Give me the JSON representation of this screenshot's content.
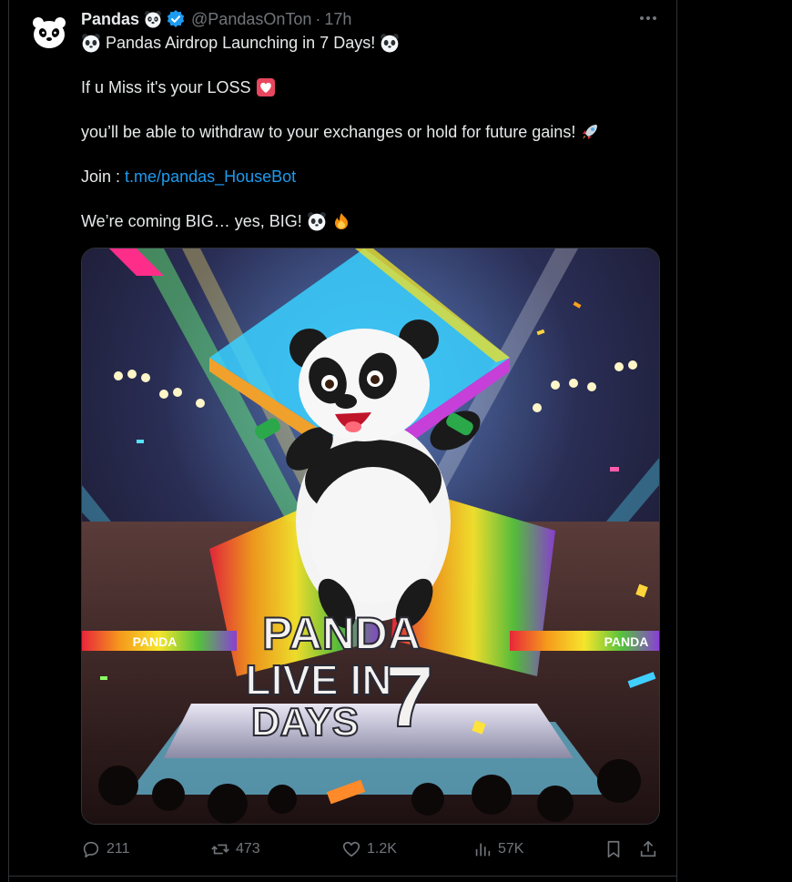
{
  "tweet": {
    "author_name": "Pandas",
    "handle": "@PandasOnTon",
    "separator": "·",
    "time": "17h",
    "line1": "Pandas Airdrop Launching in 7 Days!",
    "line2": "If u Miss it's your LOSS",
    "line3": "you’ll be able to withdraw to your exchanges or hold for future gains!",
    "line4_prefix": "Join :",
    "line4_link": "t.me/pandas_HouseBot",
    "line5": "We’re coming BIG… yes, BIG!",
    "icons": [
      "panda-face-emoji",
      "verified-badge",
      "heart-emoji",
      "rocket-emoji",
      "fire-emoji",
      "more-icon"
    ]
  },
  "image": {
    "title_line1": "PANDA",
    "title_line2": "LIVE IN",
    "title_line3": "DAYS",
    "title_number": "7",
    "banner_left": "PANDA",
    "banner_right": "PANDA"
  },
  "actions": {
    "replies": "211",
    "reposts": "473",
    "likes": "1.2K",
    "views": "57K"
  },
  "colors": {
    "link": "#1d9bf0",
    "verified": "#1d9bf0",
    "muted": "#71767b"
  }
}
